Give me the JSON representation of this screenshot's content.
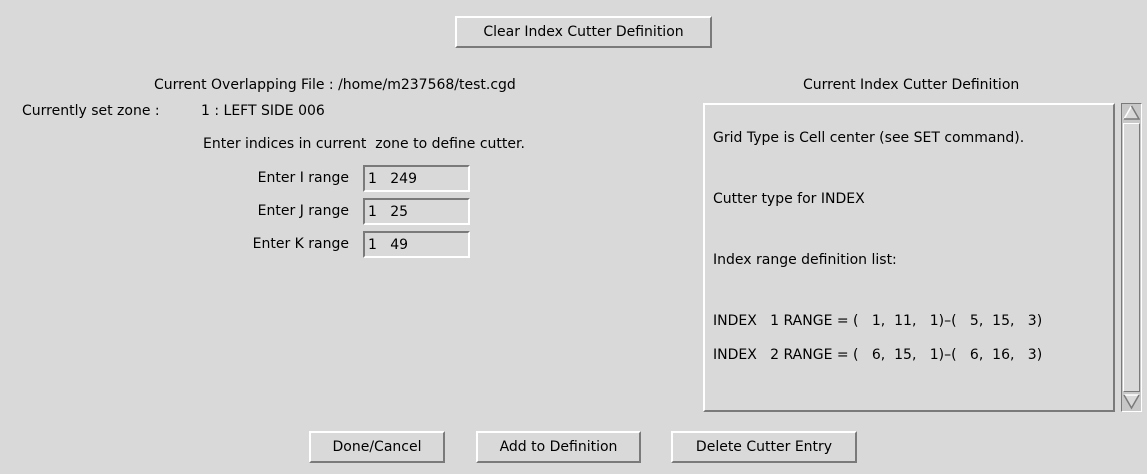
{
  "toolbar": {
    "clear_label": "Clear Index Cutter Definition"
  },
  "left": {
    "overlap_file": "Current Overlapping File : /home/m237568/test.cgd",
    "zone_label": "Currently set zone :",
    "zone_value": "1 : LEFT SIDE 006",
    "instruction": "Enter indices in current  zone to define cutter.",
    "ranges": [
      {
        "label": "Enter I range",
        "value": "1   249"
      },
      {
        "label": "Enter J range",
        "value": "1   25"
      },
      {
        "label": "Enter K range",
        "value": "1   49"
      }
    ]
  },
  "right": {
    "title": "Current Index Cutter Definition",
    "lines": [
      "Grid Type is Cell center (see SET command).",
      "Cutter type for INDEX",
      "Index range definition list:",
      "INDEX   1 RANGE = (   1,  11,   1)–(   5,  15,   3)",
      "INDEX   2 RANGE = (   6,  15,   1)–(   6,  16,   3)"
    ]
  },
  "footer": {
    "done_label": "Done/Cancel",
    "add_label": "Add to Definition",
    "delete_label": "Delete Cutter Entry"
  },
  "icons": {
    "scroll_up": "scroll-up-arrow-icon",
    "scroll_down": "scroll-down-arrow-icon"
  },
  "colors": {
    "background": "#d9d9d9",
    "highlight": "#ffffff",
    "shadow": "#7a7a7a"
  }
}
